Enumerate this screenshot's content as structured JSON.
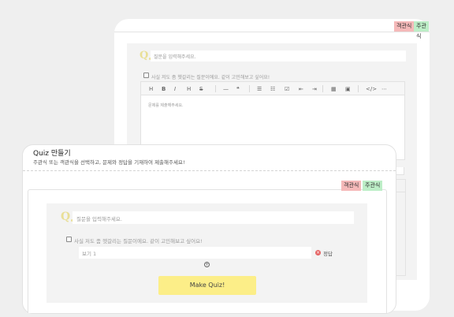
{
  "back": {
    "tags": {
      "objective": "객관식",
      "subjective": "주관식"
    },
    "question_placeholder": "질문을 입력해주세요.",
    "checkbox_label": "사실 저도 좀 헷갈리는 질문이에요. 같이 고민해보고 싶어요!",
    "toolbar": [
      "H",
      "B",
      "I",
      "H",
      "S",
      "—",
      "❝",
      "☰",
      "☷",
      "☑",
      "⇤",
      "⇥",
      "▦",
      "▣",
      "</>",
      "⋯"
    ],
    "editor_placeholder": "문제를 제출해주세요."
  },
  "front": {
    "title": "Quiz 만들기",
    "subtitle": "주관식 또는 객관식을 선택하고, 문제와 정답을 기재하여 제출해주세요!",
    "tags": {
      "objective": "객관식",
      "subjective": "주관식"
    },
    "question_placeholder": "질문을 입력해주세요.",
    "checkbox_label": "사실 저도 좀 헷갈리는 질문이에요. 같이 고민해보고 싶어요!",
    "option_placeholder": "보기 1",
    "answer_label": "정답",
    "submit_label": "Make Quiz!"
  }
}
